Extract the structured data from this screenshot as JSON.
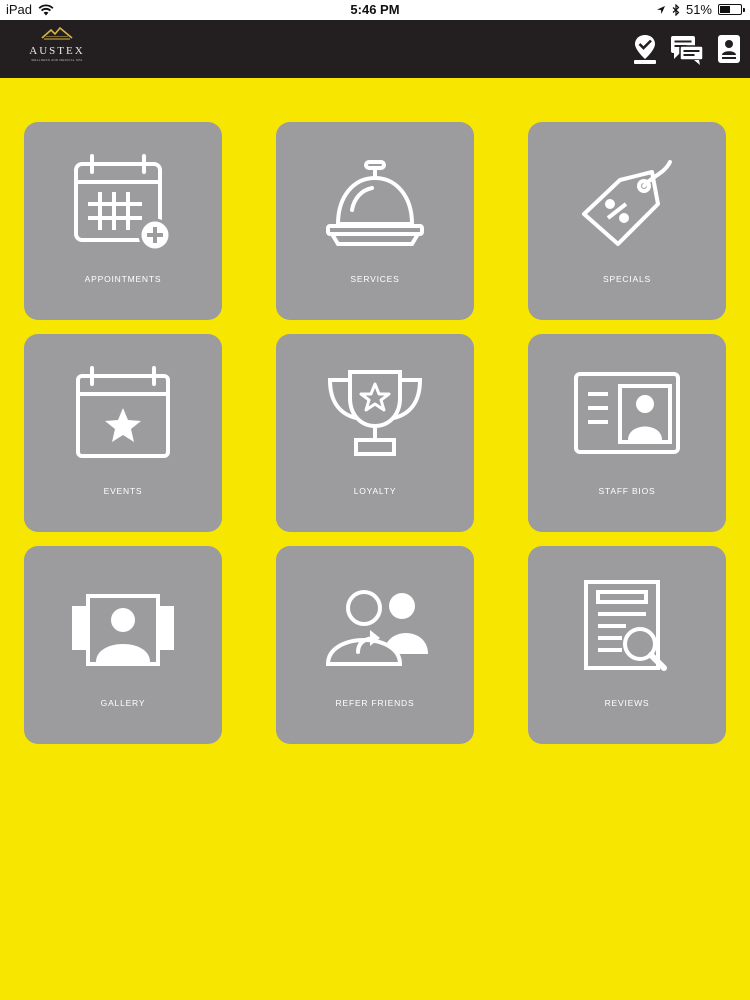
{
  "status_bar": {
    "device": "iPad",
    "time": "5:46 PM",
    "battery_text": "51%",
    "battery_level": 0.51
  },
  "header": {
    "logo_name": "AUSTEX",
    "logo_tagline": "WELLNESS AND MEDICAL SPA",
    "icons": [
      "check-in-badge-icon",
      "messages-icon",
      "profile-card-icon"
    ]
  },
  "tiles": [
    {
      "label": "APPOINTMENTS",
      "icon": "calendar-plus-icon"
    },
    {
      "label": "SERVICES",
      "icon": "service-bell-icon"
    },
    {
      "label": "SPECIALS",
      "icon": "percent-tag-icon"
    },
    {
      "label": "EVENTS",
      "icon": "calendar-star-icon"
    },
    {
      "label": "LOYALTY",
      "icon": "trophy-icon"
    },
    {
      "label": "STAFF BIOS",
      "icon": "id-card-icon"
    },
    {
      "label": "GALLERY",
      "icon": "photo-gallery-icon"
    },
    {
      "label": "REFER FRIENDS",
      "icon": "refer-users-icon"
    },
    {
      "label": "REVIEWS",
      "icon": "document-search-icon"
    }
  ],
  "colors": {
    "background": "#f6e600",
    "tile": "#9c9b9e",
    "header": "#231f20",
    "icon": "#ffffff"
  }
}
